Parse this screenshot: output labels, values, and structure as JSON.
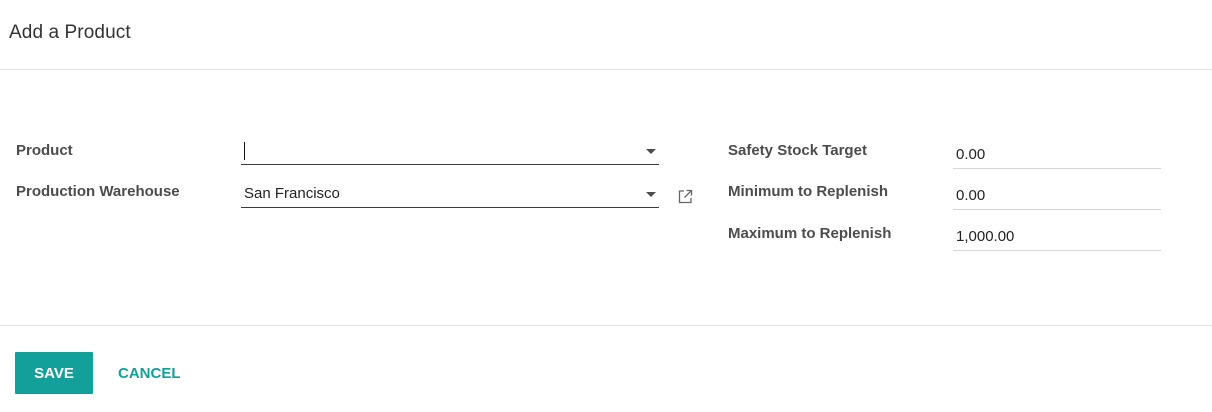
{
  "dialog": {
    "title": "Add a Product"
  },
  "form": {
    "product": {
      "label": "Product",
      "value": ""
    },
    "warehouse": {
      "label": "Production Warehouse",
      "value": "San Francisco"
    },
    "safety_stock": {
      "label": "Safety Stock Target",
      "value": "0.00"
    },
    "min_replenish": {
      "label": "Minimum to Replenish",
      "value": "0.00"
    },
    "max_replenish": {
      "label": "Maximum to Replenish",
      "value": "1,000.00"
    }
  },
  "footer": {
    "save_label": "SAVE",
    "cancel_label": "CANCEL"
  },
  "colors": {
    "accent": "#14a09a",
    "label": "#4c4c4c",
    "divider": "#e2e2e2"
  },
  "icons": {
    "dropdown": "caret-down-icon",
    "external": "external-link-icon"
  }
}
